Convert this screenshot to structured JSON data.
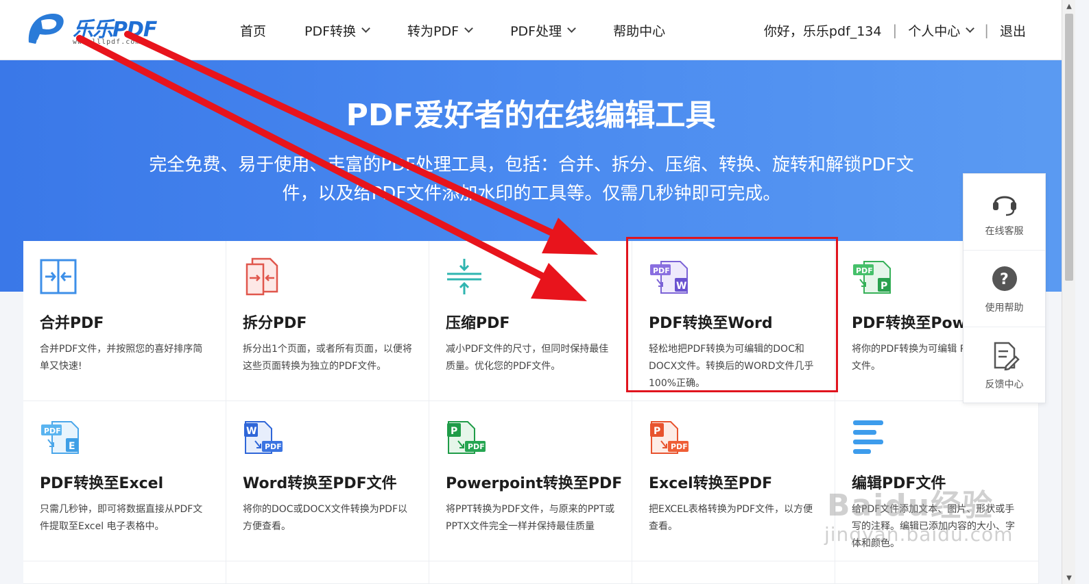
{
  "header": {
    "logo_text": "乐乐PDF",
    "logo_url": "www.lllpdf.com",
    "nav": [
      {
        "label": "首页",
        "has_dropdown": false
      },
      {
        "label": "PDF转换",
        "has_dropdown": true
      },
      {
        "label": "转为PDF",
        "has_dropdown": true
      },
      {
        "label": "PDF处理",
        "has_dropdown": true
      },
      {
        "label": "帮助中心",
        "has_dropdown": false
      }
    ],
    "greeting": "你好，乐乐pdf_134",
    "personal_center": "个人中心",
    "logout": "退出"
  },
  "hero": {
    "title": "PDF爱好者的在线编辑工具",
    "subtitle_line1": "完全免费、易于使用、丰富的PDF处理工具，包括：合并、拆分、压缩、转换、旋转和解锁PDF文",
    "subtitle_line2": "件，以及给PDF文件添加水印的工具等。仅需几秒钟即可完成。"
  },
  "tools": [
    {
      "title": "合并PDF",
      "desc": "合并PDF文件，并按照您的喜好排序简单又快速!",
      "icon": "merge-icon"
    },
    {
      "title": "拆分PDF",
      "desc": "拆分出1个页面，或者所有页面，以便将这些页面转换为独立的PDF文件。",
      "icon": "split-icon"
    },
    {
      "title": "压缩PDF",
      "desc": "减小PDF文件的尺寸，但同时保持最佳质量。优化您的PDF文件。",
      "icon": "compress-icon"
    },
    {
      "title": "PDF转换至Word",
      "desc": "轻松地把PDF转换为可编辑的DOC和DOCX文件。转换后的WORD文件几乎100%正确。",
      "icon": "pdf-to-word-icon"
    },
    {
      "title": "PDF转换至Pow",
      "desc": "将你的PDF转换为可编辑 PPTX幻灯片文件。",
      "icon": "pdf-to-ppt-icon"
    },
    {
      "title": "PDF转换至Excel",
      "desc": "只需几秒钟，即可将数据直接从PDF文件提取至Excel 电子表格中。",
      "icon": "pdf-to-excel-icon"
    },
    {
      "title": "Word转换至PDF文件",
      "desc": "将你的DOC或DOCX文件转换为PDF以方便查看。",
      "icon": "word-to-pdf-icon"
    },
    {
      "title": "Powerpoint转换至PDF",
      "desc": "将PPT转换为PDF文件，与原来的PPT或PPTX文件完全一样并保持最佳质量",
      "icon": "ppt-to-pdf-icon"
    },
    {
      "title": "Excel转换至PDF",
      "desc": "把EXCEL表格转换为PDF文件，以方便查看。",
      "icon": "excel-to-pdf-icon"
    },
    {
      "title": "编辑PDF文件",
      "desc": "给PDF文件添加文本、图片、形状或手写的注释。编辑已添加内容的大小、字体和颜色。",
      "icon": "edit-pdf-icon"
    }
  ],
  "side_panel": [
    {
      "label": "在线客服",
      "icon": "headset-icon"
    },
    {
      "label": "使用帮助",
      "icon": "help-icon"
    },
    {
      "label": "反馈中心",
      "icon": "feedback-icon"
    }
  ],
  "watermark": {
    "main": "Baidu经验",
    "sub": "jingyan.baidu.com"
  },
  "colors": {
    "hero_blue": "#3a78e8",
    "brand_blue": "#1f6fd4",
    "highlight_red": "#e0141e"
  }
}
